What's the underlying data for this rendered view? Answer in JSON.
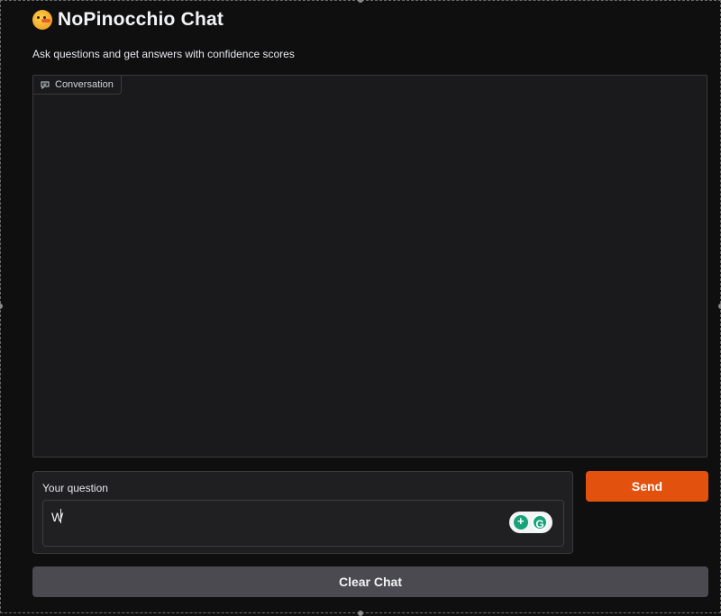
{
  "app": {
    "title": "NoPinocchio Chat",
    "title_icon": "lying-face-emoji-icon",
    "subtitle": "Ask questions and get answers with confidence scores"
  },
  "chatbot": {
    "label": "Conversation",
    "label_icon": "chat-bubble-icon",
    "messages": []
  },
  "question": {
    "label": "Your question",
    "value": "W"
  },
  "grammarly": {
    "icons": [
      "grammarly-suggestion-icon",
      "grammarly-logo-icon"
    ],
    "logo_text": "G"
  },
  "buttons": {
    "send": "Send",
    "clear": "Clear Chat"
  },
  "colors": {
    "accent": "#e2520e",
    "background": "#0f0f10",
    "panel": "#1a1a1c",
    "secondary_button": "#4a4a50",
    "grammarly_green": "#15a37a"
  }
}
